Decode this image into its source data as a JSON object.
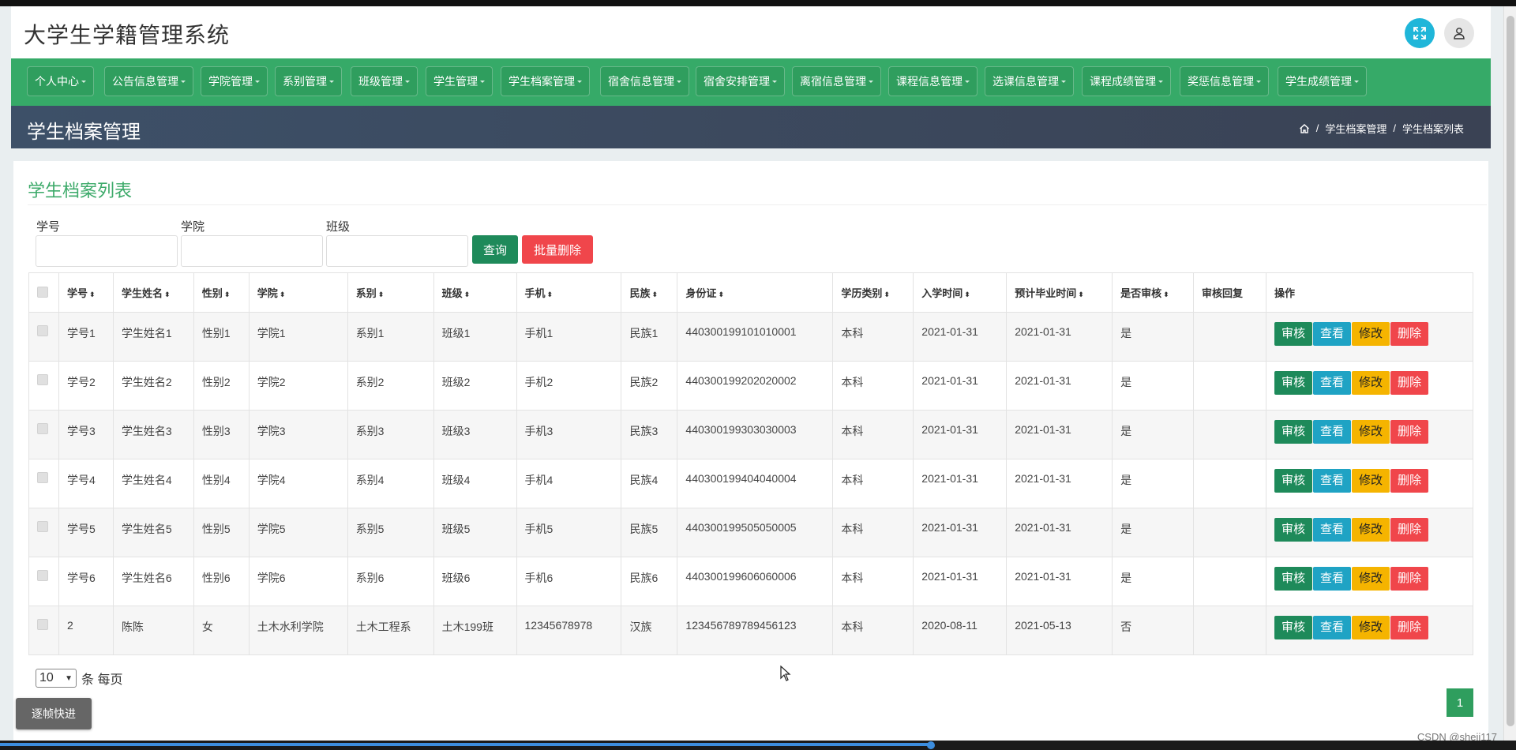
{
  "app": {
    "title": "大学生学籍管理系统"
  },
  "nav": {
    "items": [
      {
        "label": "个人中心"
      },
      {
        "label": "公告信息管理"
      },
      {
        "label": "学院管理"
      },
      {
        "label": "系别管理"
      },
      {
        "label": "班级管理"
      },
      {
        "label": "学生管理"
      },
      {
        "label": "学生档案管理"
      },
      {
        "label": "宿舍信息管理"
      },
      {
        "label": "宿舍安排管理"
      },
      {
        "label": "离宿信息管理"
      },
      {
        "label": "课程信息管理"
      },
      {
        "label": "选课信息管理"
      },
      {
        "label": "课程成绩管理"
      },
      {
        "label": "奖惩信息管理"
      },
      {
        "label": "学生成绩管理"
      }
    ]
  },
  "page": {
    "title": "学生档案管理",
    "breadcrumb": [
      "学生档案管理",
      "学生档案列表"
    ]
  },
  "list": {
    "title": "学生档案列表",
    "filters": {
      "student_no": {
        "label": "学号",
        "value": ""
      },
      "college": {
        "label": "学院",
        "value": ""
      },
      "class": {
        "label": "班级",
        "value": ""
      }
    },
    "query_label": "查询",
    "batch_delete_label": "批量删除",
    "columns": [
      "学号",
      "学生姓名",
      "性别",
      "学院",
      "系别",
      "班级",
      "手机",
      "民族",
      "身份证",
      "学历类别",
      "入学时间",
      "预计毕业时间",
      "是否审核",
      "审核回复",
      "操作"
    ],
    "actions": {
      "audit": "审核",
      "view": "查看",
      "edit": "修改",
      "delete": "删除"
    },
    "rows": [
      [
        "学号1",
        "学生姓名1",
        "性别1",
        "学院1",
        "系别1",
        "班级1",
        "手机1",
        "民族1",
        "440300199101010001",
        "本科",
        "2021-01-31",
        "2021-01-31",
        "是",
        ""
      ],
      [
        "学号2",
        "学生姓名2",
        "性别2",
        "学院2",
        "系别2",
        "班级2",
        "手机2",
        "民族2",
        "440300199202020002",
        "本科",
        "2021-01-31",
        "2021-01-31",
        "是",
        ""
      ],
      [
        "学号3",
        "学生姓名3",
        "性别3",
        "学院3",
        "系别3",
        "班级3",
        "手机3",
        "民族3",
        "440300199303030003",
        "本科",
        "2021-01-31",
        "2021-01-31",
        "是",
        ""
      ],
      [
        "学号4",
        "学生姓名4",
        "性别4",
        "学院4",
        "系别4",
        "班级4",
        "手机4",
        "民族4",
        "440300199404040004",
        "本科",
        "2021-01-31",
        "2021-01-31",
        "是",
        ""
      ],
      [
        "学号5",
        "学生姓名5",
        "性别5",
        "学院5",
        "系别5",
        "班级5",
        "手机5",
        "民族5",
        "440300199505050005",
        "本科",
        "2021-01-31",
        "2021-01-31",
        "是",
        ""
      ],
      [
        "学号6",
        "学生姓名6",
        "性别6",
        "学院6",
        "系别6",
        "班级6",
        "手机6",
        "民族6",
        "440300199606060006",
        "本科",
        "2021-01-31",
        "2021-01-31",
        "是",
        ""
      ],
      [
        "2",
        "陈陈",
        "女",
        "土木水利学院",
        "土木工程系",
        "土木199班",
        "12345678978",
        "汉族",
        "123456789789456123",
        "本科",
        "2020-08-11",
        "2021-05-13",
        "否",
        ""
      ]
    ],
    "page_size": "10",
    "page_size_suffix": "条 每页",
    "current_page": "1"
  },
  "overlay": {
    "fast_forward_label": "逐帧快进",
    "watermark": "CSDN @sheji117"
  },
  "icons": {
    "expand": "expand-arrows-icon",
    "user": "user-icon",
    "home": "home-icon"
  },
  "colors": {
    "nav_green": "#36aa68",
    "title_green": "#3daa6a",
    "audit": "#1e8a5a",
    "view": "#1fa3c4",
    "edit": "#f5b400",
    "delete": "#f0464b"
  }
}
